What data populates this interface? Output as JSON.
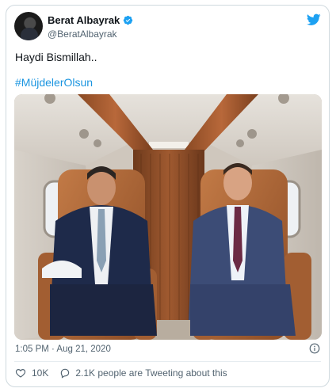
{
  "tweet": {
    "author_name": "Berat Albayrak",
    "author_handle": "@BeratAlbayrak",
    "text": "Haydi Bismillah..",
    "hashtag": "#MüjdelerOlsun",
    "timestamp": "1:05 PM · Aug 21, 2020",
    "likes": "10K",
    "tweeting_about": "2.1K people are Tweeting about this"
  },
  "colors": {
    "link": "#1b95e0",
    "verified": "#1da1f2",
    "twitter_blue": "#1da1f2",
    "muted": "#536471",
    "border": "#cfd9de"
  },
  "icons": {
    "logo": "twitter-bird-icon",
    "verified": "verified-badge-icon",
    "info": "info-icon",
    "like": "heart-icon",
    "reply": "speech-bubble-icon"
  }
}
